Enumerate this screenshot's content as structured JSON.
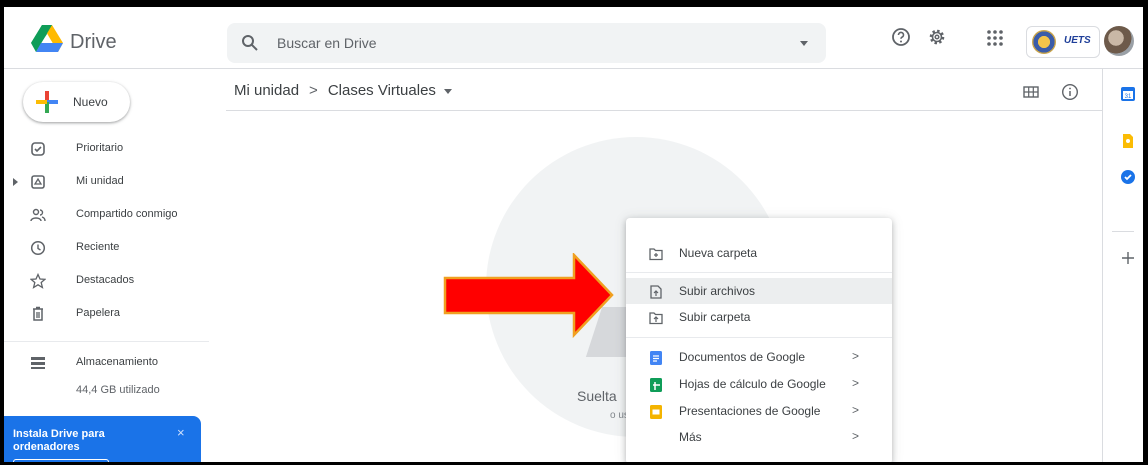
{
  "header": {
    "app_name": "Drive",
    "search_placeholder": "Buscar en Drive",
    "account_brand": "UETS"
  },
  "sidebar": {
    "new_button": "Nuevo",
    "items": [
      {
        "label": "Prioritario",
        "icon": "check-circle-icon"
      },
      {
        "label": "Mi unidad",
        "icon": "my-drive-icon"
      },
      {
        "label": "Compartido conmigo",
        "icon": "shared-people-icon"
      },
      {
        "label": "Reciente",
        "icon": "clock-icon"
      },
      {
        "label": "Destacados",
        "icon": "star-icon"
      },
      {
        "label": "Papelera",
        "icon": "trash-icon"
      }
    ],
    "storage": {
      "label": "Almacenamiento",
      "usage": "44,4 GB utilizado"
    },
    "promo": {
      "title": "Instala Drive para ordenadores",
      "close": "×"
    }
  },
  "main": {
    "breadcrumb": {
      "root": "Mi unidad",
      "separator": ">",
      "current": "Clases Virtuales"
    },
    "drop_title": "Suelta",
    "drop_subtitle": "o us"
  },
  "context_menu": {
    "items": [
      {
        "label": "Nueva carpeta",
        "icon": "new-folder-icon",
        "highlighted": false
      },
      {
        "label": "Subir archivos",
        "icon": "file-upload-icon",
        "highlighted": true
      },
      {
        "label": "Subir carpeta",
        "icon": "folder-upload-icon",
        "highlighted": false
      },
      {
        "label": "Documentos de Google",
        "icon": "google-docs-icon",
        "submenu": ">"
      },
      {
        "label": "Hojas de cálculo de Google",
        "icon": "google-sheets-icon",
        "submenu": ">"
      },
      {
        "label": "Presentaciones de Google",
        "icon": "google-slides-icon",
        "submenu": ">"
      },
      {
        "label": "Más",
        "icon": "",
        "submenu": ">"
      }
    ]
  },
  "rail": {
    "calendar_day": "31"
  },
  "colors": {
    "accent": "#1a73e8",
    "arrow_fill": "#ff0000",
    "arrow_outline": "#f0a020",
    "docs": "#4285f4",
    "sheets": "#0f9d58",
    "slides": "#f4b400"
  }
}
